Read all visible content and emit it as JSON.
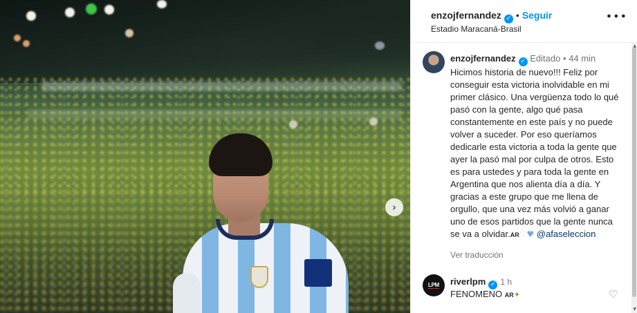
{
  "post_header": {
    "username": "enzojfernandez",
    "separator": "•",
    "follow_label": "Seguir",
    "location": "Estadio Maracaná-Brasil"
  },
  "caption": {
    "username": "enzojfernandez",
    "edited_label": "Editado",
    "separator": "•",
    "time": "44 min",
    "text": "Hicimos historia de nuevo!!! Feliz por conseguir esta victoria inolvidable en mi primer clásico. Una vergüenza todo lo qué pasó con la gente, algo qué pasa constantemente en este país y no puede volver a suceder. Por eso queríamos dedicarle esta victoria a toda la gente que ayer la pasó mal por culpa de otros. Esto es para ustedes y para toda la gente en Argentina que nos alienta día a día. Y gracias a este grupo que me llena de orgullo, que una vez más volvió a ganar uno de esos partidos que la gente nunca se va a olvidar.",
    "flag_text": "AR",
    "mention": "@afaseleccion",
    "translate_label": "Ver traducción"
  },
  "comment": {
    "username": "riverlpm",
    "time": "1 h",
    "avatar_text": "LPM",
    "text": "FENOMENO",
    "flag_text": "AR"
  },
  "icons": {
    "verified": "verified-badge-icon",
    "more": "more-options-icon",
    "next": "chevron-right-icon",
    "like": "heart-outline-icon",
    "white_heart": "white-heart-emoji",
    "blue_heart": "light-blue-heart-emoji",
    "wand": "magic-wand-emoji"
  },
  "colors": {
    "accent": "#0095f6",
    "text": "#262626",
    "secondary": "#737373",
    "mention": "#00376b"
  }
}
